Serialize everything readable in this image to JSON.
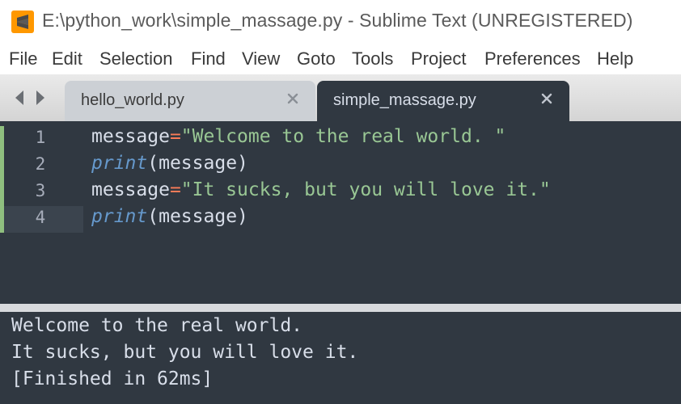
{
  "window": {
    "title": "E:\\python_work\\simple_massage.py - Sublime Text (UNREGISTERED)",
    "app_icon": "sublime-text-icon",
    "accent": "#ff9800"
  },
  "menu": {
    "items": [
      "File",
      "Edit",
      "Selection",
      "Find",
      "View",
      "Goto",
      "Tools",
      "Project",
      "Preferences",
      "Help"
    ]
  },
  "tabs": [
    {
      "label": "hello_world.py",
      "active": false,
      "close_icon": "close-icon"
    },
    {
      "label": "simple_massage.py",
      "active": true,
      "close_icon": "close-icon"
    }
  ],
  "editor": {
    "current_line": 4,
    "lines": [
      {
        "number": "1",
        "tokens": [
          {
            "text": "message",
            "kind": "ident"
          },
          {
            "text": "=",
            "kind": "op"
          },
          {
            "text": "\"Welcome to the real world. \"",
            "kind": "str"
          }
        ]
      },
      {
        "number": "2",
        "tokens": [
          {
            "text": "print",
            "kind": "fn"
          },
          {
            "text": "(",
            "kind": "punc"
          },
          {
            "text": "message",
            "kind": "ident"
          },
          {
            "text": ")",
            "kind": "punc"
          }
        ]
      },
      {
        "number": "3",
        "tokens": [
          {
            "text": "message",
            "kind": "ident"
          },
          {
            "text": "=",
            "kind": "op"
          },
          {
            "text": "\"It sucks, but you will love it.\"",
            "kind": "str"
          }
        ]
      },
      {
        "number": "4",
        "tokens": [
          {
            "text": "print",
            "kind": "fn"
          },
          {
            "text": "(",
            "kind": "punc"
          },
          {
            "text": "message",
            "kind": "ident"
          },
          {
            "text": ")",
            "kind": "punc"
          }
        ]
      }
    ]
  },
  "output": {
    "lines": [
      "Welcome to the real world.",
      "It sucks, but you will love it.",
      "[Finished in 62ms]"
    ]
  },
  "colors": {
    "editor_bg": "#303841",
    "string": "#99c794",
    "operator": "#f97b58",
    "function": "#6699cc",
    "text": "#d8dee9"
  }
}
